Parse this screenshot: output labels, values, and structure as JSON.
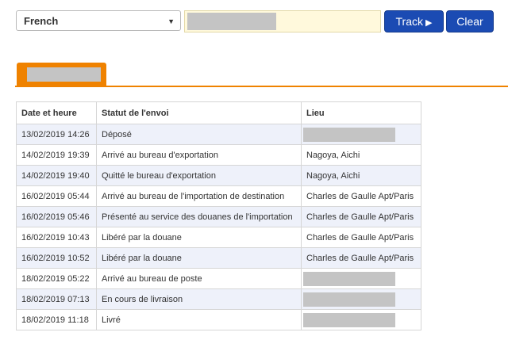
{
  "toolbar": {
    "language": "French",
    "track_label": "Track",
    "clear_label": "Clear"
  },
  "table": {
    "headers": [
      "Date et heure",
      "Statut de l'envoi",
      "Lieu"
    ],
    "rows": [
      {
        "date": "13/02/2019 14:26",
        "status": "Déposé",
        "place": ""
      },
      {
        "date": "14/02/2019 19:39",
        "status": "Arrivé au bureau d'exportation",
        "place": "Nagoya, Aichi"
      },
      {
        "date": "14/02/2019 19:40",
        "status": "Quitté le bureau d'exportation",
        "place": "Nagoya, Aichi"
      },
      {
        "date": "16/02/2019 05:44",
        "status": "Arrivé au bureau de l'importation de destination",
        "place": "Charles de Gaulle Apt/Paris"
      },
      {
        "date": "16/02/2019 05:46",
        "status": "Présenté au service des douanes de l'importation",
        "place": "Charles de Gaulle Apt/Paris"
      },
      {
        "date": "16/02/2019 10:43",
        "status": "Libéré par la douane",
        "place": "Charles de Gaulle Apt/Paris"
      },
      {
        "date": "16/02/2019 10:52",
        "status": "Libéré par la douane",
        "place": "Charles de Gaulle Apt/Paris"
      },
      {
        "date": "18/02/2019 05:22",
        "status": "Arrivé au bureau de poste",
        "place": ""
      },
      {
        "date": "18/02/2019 07:13",
        "status": "En cours de livraison",
        "place": ""
      },
      {
        "date": "18/02/2019 11:18",
        "status": "Livré",
        "place": ""
      }
    ]
  },
  "colors": {
    "button": "#1b4bb3",
    "tab_accent": "#ef8200",
    "row_stripe": "#eef1fa",
    "redaction": "#c4c4c4"
  },
  "icons": {
    "dropdown": "chevron-down-icon",
    "track": "play-icon"
  }
}
